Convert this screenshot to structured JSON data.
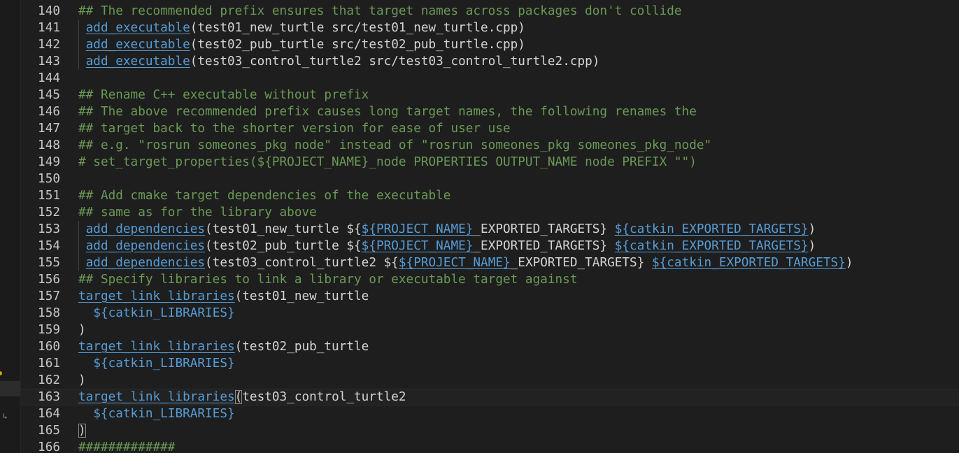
{
  "editor": {
    "lines": [
      {
        "number": "140",
        "guide": false,
        "current": false,
        "tokens": [
          {
            "t": "## The recommended prefix ensures that target names across packages don't collide",
            "k": "comment"
          }
        ]
      },
      {
        "number": "141",
        "guide": true,
        "current": false,
        "tokens": [
          {
            "t": " ",
            "k": "plain"
          },
          {
            "t": "add_executable",
            "k": "func"
          },
          {
            "t": "(test01_new_turtle src/test01_new_turtle.cpp)",
            "k": "plain"
          }
        ]
      },
      {
        "number": "142",
        "guide": true,
        "current": false,
        "tokens": [
          {
            "t": " ",
            "k": "plain"
          },
          {
            "t": "add_executable",
            "k": "func"
          },
          {
            "t": "(test02_pub_turtle src/test02_pub_turtle.cpp)",
            "k": "plain"
          }
        ]
      },
      {
        "number": "143",
        "guide": true,
        "current": false,
        "tokens": [
          {
            "t": " ",
            "k": "plain"
          },
          {
            "t": "add_executable",
            "k": "func"
          },
          {
            "t": "(test03_control_turtle2 src/test03_control_turtle2.cpp)",
            "k": "plain"
          }
        ]
      },
      {
        "number": "144",
        "guide": false,
        "current": false,
        "tokens": []
      },
      {
        "number": "145",
        "guide": false,
        "current": false,
        "tokens": [
          {
            "t": "## Rename C++ executable without prefix",
            "k": "comment"
          }
        ]
      },
      {
        "number": "146",
        "guide": false,
        "current": false,
        "tokens": [
          {
            "t": "## The above recommended prefix causes long target names, the following renames the",
            "k": "comment"
          }
        ]
      },
      {
        "number": "147",
        "guide": false,
        "current": false,
        "tokens": [
          {
            "t": "## target back to the shorter version for ease of user use",
            "k": "comment"
          }
        ]
      },
      {
        "number": "148",
        "guide": false,
        "current": false,
        "tokens": [
          {
            "t": "## e.g. \"rosrun someones_pkg node\" instead of \"rosrun someones_pkg someones_pkg_node\"",
            "k": "comment"
          }
        ]
      },
      {
        "number": "149",
        "guide": false,
        "current": false,
        "tokens": [
          {
            "t": "# set_target_properties(${PROJECT_NAME}_node PROPERTIES OUTPUT_NAME node PREFIX \"\")",
            "k": "comment"
          }
        ]
      },
      {
        "number": "150",
        "guide": false,
        "current": false,
        "tokens": []
      },
      {
        "number": "151",
        "guide": false,
        "current": false,
        "tokens": [
          {
            "t": "## Add cmake target dependencies of the executable",
            "k": "comment"
          }
        ]
      },
      {
        "number": "152",
        "guide": false,
        "current": false,
        "tokens": [
          {
            "t": "## same as for the library above",
            "k": "comment"
          }
        ]
      },
      {
        "number": "153",
        "guide": true,
        "current": false,
        "tokens": [
          {
            "t": " ",
            "k": "plain"
          },
          {
            "t": "add_dependencies",
            "k": "func"
          },
          {
            "t": "(test01_new_turtle ${",
            "k": "plain"
          },
          {
            "t": "${PROJECT_NAME}",
            "k": "var"
          },
          {
            "t": "_EXPORTED_TARGETS} ",
            "k": "plain"
          },
          {
            "t": "${catkin_EXPORTED_TARGETS}",
            "k": "var"
          },
          {
            "t": ")",
            "k": "plain"
          }
        ]
      },
      {
        "number": "154",
        "guide": true,
        "current": false,
        "tokens": [
          {
            "t": " ",
            "k": "plain"
          },
          {
            "t": "add_dependencies",
            "k": "func"
          },
          {
            "t": "(test02_pub_turtle ${",
            "k": "plain"
          },
          {
            "t": "${PROJECT_NAME}",
            "k": "var"
          },
          {
            "t": "_EXPORTED_TARGETS} ",
            "k": "plain"
          },
          {
            "t": "${catkin_EXPORTED_TARGETS}",
            "k": "var"
          },
          {
            "t": ")",
            "k": "plain"
          }
        ]
      },
      {
        "number": "155",
        "guide": true,
        "current": false,
        "tokens": [
          {
            "t": " ",
            "k": "plain"
          },
          {
            "t": "add_dependencies",
            "k": "func"
          },
          {
            "t": "(test03_control_turtle2 ${",
            "k": "plain"
          },
          {
            "t": "${PROJECT_NAME}",
            "k": "var"
          },
          {
            "t": "_EXPORTED_TARGETS} ",
            "k": "plain"
          },
          {
            "t": "${catkin_EXPORTED_TARGETS}",
            "k": "var"
          },
          {
            "t": ")",
            "k": "plain"
          }
        ]
      },
      {
        "number": "156",
        "guide": false,
        "current": false,
        "tokens": [
          {
            "t": "## Specify libraries to link a library or executable target against",
            "k": "comment"
          }
        ]
      },
      {
        "number": "157",
        "guide": false,
        "current": false,
        "tokens": [
          {
            "t": "target_link_libraries",
            "k": "func"
          },
          {
            "t": "(test01_new_turtle",
            "k": "plain"
          }
        ]
      },
      {
        "number": "158",
        "guide": false,
        "current": false,
        "tokens": [
          {
            "t": "  ",
            "k": "plain"
          },
          {
            "t": "${catkin_LIBRARIES}",
            "k": "varplain"
          }
        ]
      },
      {
        "number": "159",
        "guide": false,
        "current": false,
        "tokens": [
          {
            "t": ")",
            "k": "plain"
          }
        ]
      },
      {
        "number": "160",
        "guide": false,
        "current": false,
        "tokens": [
          {
            "t": "target_link_libraries",
            "k": "func"
          },
          {
            "t": "(test02_pub_turtle",
            "k": "plain"
          }
        ]
      },
      {
        "number": "161",
        "guide": false,
        "current": false,
        "tokens": [
          {
            "t": "  ",
            "k": "plain"
          },
          {
            "t": "${catkin_LIBRARIES}",
            "k": "varplain"
          }
        ]
      },
      {
        "number": "162",
        "guide": false,
        "current": false,
        "tokens": [
          {
            "t": ")",
            "k": "plain"
          }
        ]
      },
      {
        "number": "163",
        "guide": false,
        "current": true,
        "tokens": [
          {
            "t": "target_link_libraries",
            "k": "func"
          },
          {
            "t": "(",
            "k": "bracket"
          },
          {
            "t": "test03_control_turtle2",
            "k": "plain"
          }
        ]
      },
      {
        "number": "164",
        "guide": false,
        "current": false,
        "tokens": [
          {
            "t": "  ",
            "k": "plain"
          },
          {
            "t": "${catkin_LIBRARIES}",
            "k": "varplain"
          }
        ]
      },
      {
        "number": "165",
        "guide": false,
        "current": false,
        "tokens": [
          {
            "t": ")",
            "k": "bracket"
          }
        ]
      },
      {
        "number": "166",
        "guide": false,
        "current": false,
        "tokens": [
          {
            "t": "#############",
            "k": "comment"
          }
        ]
      }
    ]
  },
  "colors": {
    "background": "#1e1e1e",
    "comment": "#6a9955",
    "function": "#569cd6",
    "text": "#d4d4d4",
    "line_number": "#c6c6c6"
  }
}
